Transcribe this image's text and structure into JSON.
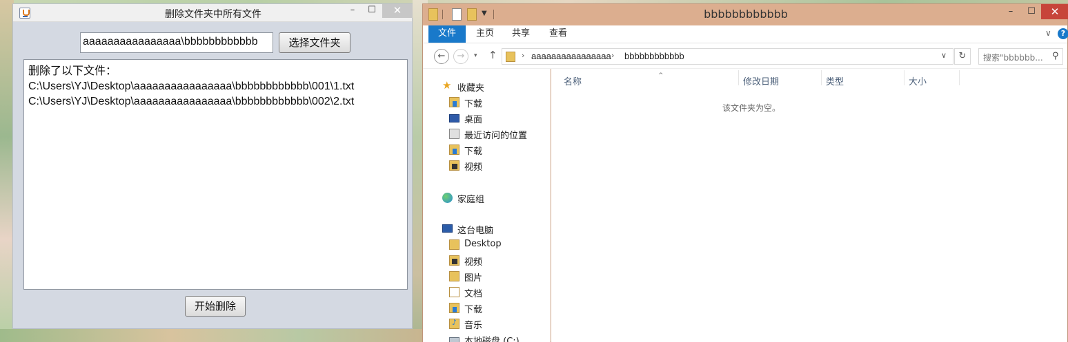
{
  "java_window": {
    "title": "删除文件夹中所有文件",
    "minimize": "–",
    "maximize": "☐",
    "close": "✕",
    "path_value": "aaaaaaaaaaaaaaaa\\bbbbbbbbbbbb",
    "choose_button": "选择文件夹",
    "log_lines": [
      "删除了以下文件：",
      "C:\\Users\\YJ\\Desktop\\aaaaaaaaaaaaaaaa\\bbbbbbbbbbbb\\001\\1.txt",
      "C:\\Users\\YJ\\Desktop\\aaaaaaaaaaaaaaaa\\bbbbbbbbbbbb\\002\\2.txt"
    ],
    "start_button": "开始删除"
  },
  "explorer": {
    "title": "bbbbbbbbbbbb",
    "minimize": "–",
    "maximize": "☐",
    "close": "✕",
    "ribbon_tabs": [
      "文件",
      "主页",
      "共享",
      "查看"
    ],
    "ribbon_expand": "∨",
    "help": "?",
    "back": "←",
    "forward": "→",
    "recent": "▾",
    "up": "↑",
    "breadcrumb": [
      "aaaaaaaaaaaaaaaa",
      "bbbbbbbbbbbb"
    ],
    "breadcrumb_sep": "›",
    "address_dropdown": "∨",
    "refresh": "↻",
    "search_placeholder": "搜索\"bbbbbb...",
    "nav": {
      "favorites": "收藏夹",
      "fav_items": [
        "下载",
        "桌面",
        "最近访问的位置",
        "下载",
        "视频"
      ],
      "homegroup": "家庭组",
      "this_pc": "这台电脑",
      "pc_items": [
        "Desktop",
        "视频",
        "图片",
        "文档",
        "下载",
        "音乐",
        "本地磁盘 (C:)"
      ]
    },
    "columns": [
      "名称",
      "修改日期",
      "类型",
      "大小"
    ],
    "sort_indicator": "^",
    "empty_message": "该文件夹为空。"
  }
}
